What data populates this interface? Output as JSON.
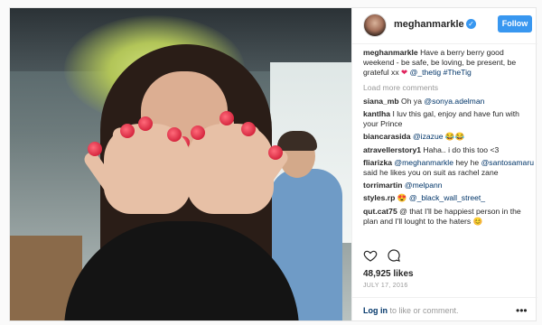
{
  "header": {
    "username": "meghanmarkle",
    "verified_icon": "verified-badge-icon",
    "follow_label": "Follow"
  },
  "caption": {
    "username": "meghanmarkle",
    "text": "Have a berry berry good weekend - be safe, be loving, be present, be grateful xx",
    "mention": "@_thetig",
    "hashtag": "#TheTig"
  },
  "load_more": "Load more comments",
  "comments": [
    {
      "user": "siana_mb",
      "text": "Oh ya",
      "mention": "@sonya.adelman"
    },
    {
      "user": "kantlha",
      "text": "I luv this gal, enjoy and have fun with your Prince",
      "mention": ""
    },
    {
      "user": "biancarasida",
      "text": "",
      "mention": "@izazue",
      "emoji": "😂😂"
    },
    {
      "user": "atravellerstory1",
      "text": "Haha.. i do this too <3",
      "mention": ""
    },
    {
      "user": "fliarizka",
      "text": "",
      "mention": "@meghanmarkle",
      "after": " hey he",
      "mention2": "@santosamaru",
      "after2": " said he likes you on suit as rachel zane"
    },
    {
      "user": "torrimartin",
      "text": "",
      "mention": "@melpann"
    },
    {
      "user": "styles.rp",
      "text": "😍",
      "mention": "@_black_wall_street_"
    },
    {
      "user": "qut.cat75",
      "text": "@ that I'll be happiest person in the plan and I'll lought to the haters 😊",
      "mention": ""
    }
  ],
  "actions": {
    "like_icon": "heart-icon",
    "comment_icon": "comment-icon"
  },
  "likes": "48,925 likes",
  "date": "JULY 17, 2016",
  "footer": {
    "login": "Log in",
    "rest": " to like or comment.",
    "more_icon": "more-options-icon",
    "more_glyph": "•••"
  }
}
